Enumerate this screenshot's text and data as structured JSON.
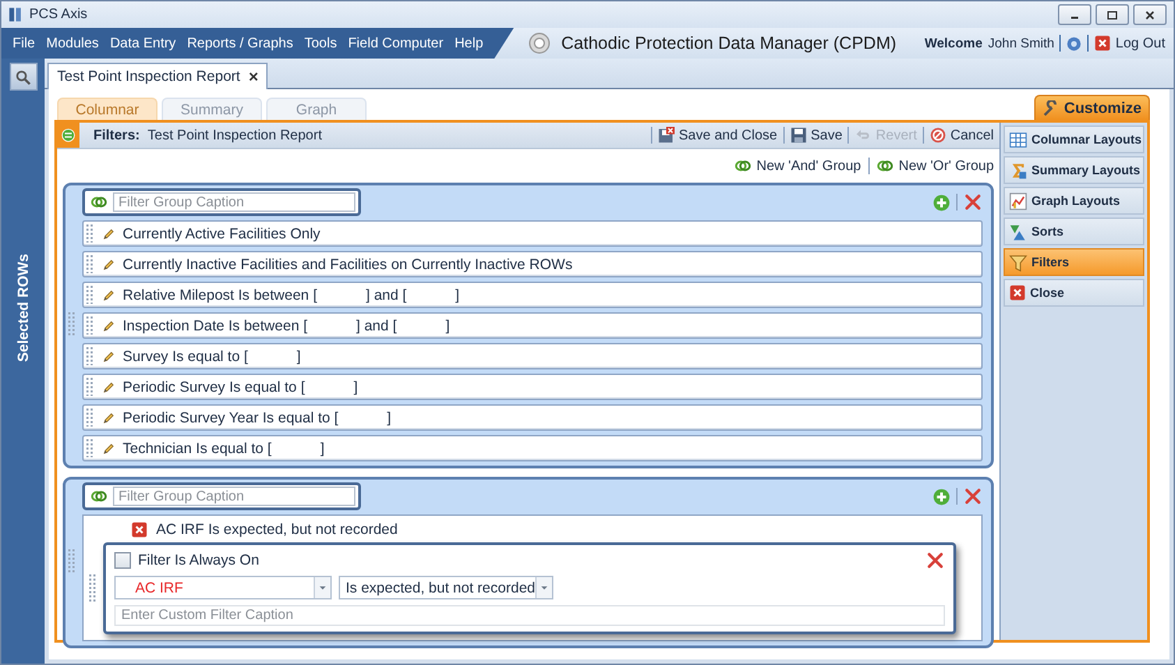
{
  "window": {
    "title": "PCS Axis"
  },
  "menu": [
    "File",
    "Modules",
    "Data Entry",
    "Reports / Graphs",
    "Tools",
    "Field Computer",
    "Help"
  ],
  "app_title": "Cathodic Protection Data Manager (CPDM)",
  "user": {
    "welcome": "Welcome",
    "name": "John Smith",
    "logout": "Log Out"
  },
  "side_strip": {
    "label": "Selected ROWs"
  },
  "doc_tabs": [
    {
      "label": "Test Point Inspection Report",
      "close": "×",
      "selected": true
    }
  ],
  "view_tabs": [
    {
      "label": "Columnar",
      "selected": true
    },
    {
      "label": "Summary",
      "selected": false
    },
    {
      "label": "Graph",
      "selected": false
    }
  ],
  "customize": {
    "label": "Customize"
  },
  "filter_panel": {
    "heading": "Filters:",
    "title": "Test Point Inspection Report",
    "toolbar": [
      {
        "kind": "save-close",
        "label": "Save and Close",
        "disabled": false
      },
      {
        "kind": "save",
        "label": "Save",
        "disabled": false
      },
      {
        "kind": "revert",
        "label": "Revert",
        "disabled": true
      },
      {
        "kind": "cancel",
        "label": "Cancel",
        "disabled": false
      }
    ],
    "group_actions": [
      "New 'And' Group",
      "New 'Or' Group"
    ],
    "groups": [
      {
        "caption_placeholder": "Filter Group Caption",
        "filters": [
          {
            "kind": "row",
            "text": "Currently Active Facilities Only"
          },
          {
            "kind": "row",
            "text": "Currently Inactive Facilities and Facilities on Currently Inactive ROWs"
          },
          {
            "kind": "row",
            "text": "Relative Milepost Is between [            ] and [            ]"
          },
          {
            "kind": "row",
            "text": "Inspection Date Is between [            ] and [            ]"
          },
          {
            "kind": "row",
            "text": "Survey Is equal to [            ]"
          },
          {
            "kind": "row",
            "text": "Periodic Survey Is equal to [            ]"
          },
          {
            "kind": "row",
            "text": "Periodic Survey Year Is equal to [            ]"
          },
          {
            "kind": "row",
            "text": "Technician Is equal to [            ]"
          }
        ]
      },
      {
        "caption_placeholder": "Filter Group Caption",
        "filters": [
          {
            "kind": "editor",
            "text": "AC IRF Is expected, but not recorded",
            "always_on": "Filter Is Always On",
            "checked": false,
            "field": "AC IRF",
            "operator": "Is expected, but not recorded",
            "caption_placeholder": "Enter Custom Filter Caption"
          }
        ]
      }
    ]
  },
  "sidebar": [
    {
      "kind": "grid",
      "label": "Columnar Layouts",
      "selected": false
    },
    {
      "kind": "sigma",
      "label": "Summary Layouts",
      "selected": false
    },
    {
      "kind": "chart",
      "label": "Graph Layouts",
      "selected": false
    },
    {
      "kind": "sort",
      "label": "Sorts",
      "selected": false
    },
    {
      "kind": "funnel",
      "label": "Filters",
      "selected": true
    },
    {
      "kind": "close",
      "label": "Close",
      "selected": false
    }
  ]
}
